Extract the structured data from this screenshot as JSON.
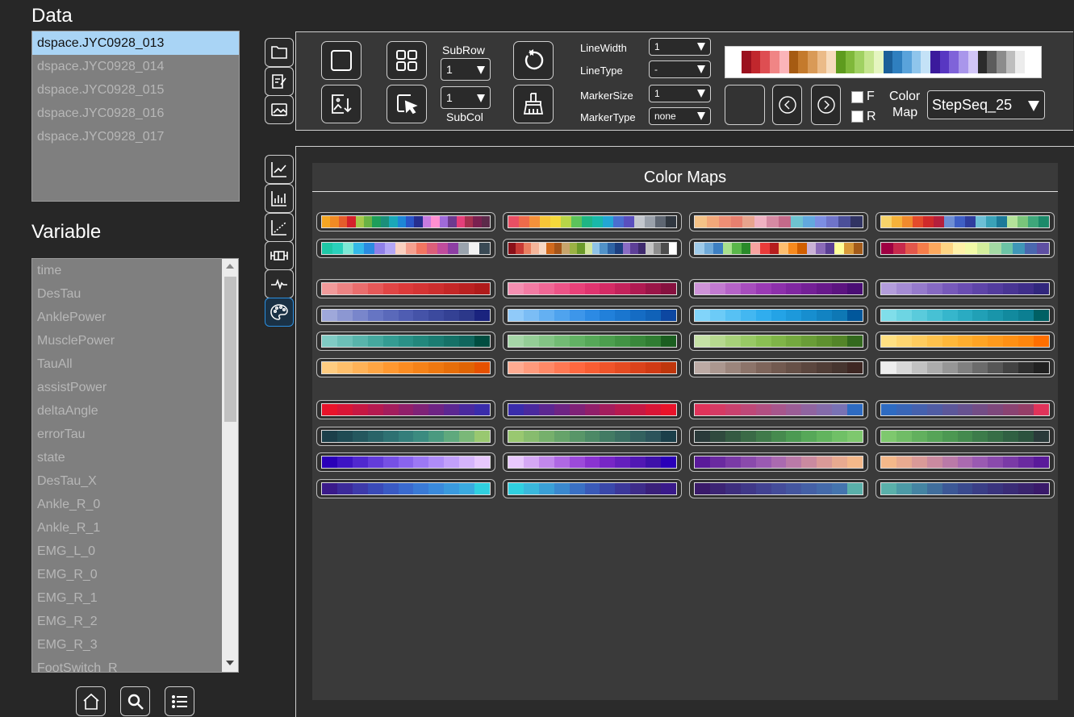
{
  "data_section": {
    "heading": "Data",
    "items": [
      "dspace.JYC0928_013",
      "dspace.JYC0928_014",
      "dspace.JYC0928_015",
      "dspace.JYC0928_016",
      "dspace.JYC0928_017"
    ],
    "selected_index": 0
  },
  "variable_section": {
    "heading": "Variable",
    "items": [
      "time",
      "DesTau",
      "AnklePower",
      "MusclePower",
      "TauAll",
      "assistPower",
      "deltaAngle",
      "errorTau",
      "state",
      "DesTau_X",
      "Ankle_R_0",
      "Ankle_R_1",
      "EMG_L_0",
      "EMG_R_0",
      "EMG_R_1",
      "EMG_R_2",
      "EMG_R_3",
      "FootSwitch_R"
    ]
  },
  "bottom_buttons": [
    "home-icon",
    "search-icon",
    "list-icon"
  ],
  "side_tools_top": [
    "folder-icon",
    "edit-icon",
    "image-icon"
  ],
  "side_tools_bottom": [
    "line-chart-icon",
    "bar-chart-icon",
    "scatter-chart-icon",
    "boxplot-icon",
    "signal-icon",
    "palette-icon"
  ],
  "toolbar": {
    "subrow_label": "SubRow",
    "subrow_value": "1",
    "subcol_label": "SubCol",
    "subcol_value": "1",
    "linewidth_label": "LineWidth",
    "linewidth_value": "1",
    "linetype_label": "LineType",
    "linetype_value": "-",
    "markersize_label": "MarkerSize",
    "markersize_value": "1",
    "markertype_label": "MarkerType",
    "markertype_value": "none",
    "f_label": "F",
    "r_label": "R",
    "colormap_label_1": "Color",
    "colormap_label_2": "Map",
    "colormap_value": "StepSeq_25",
    "preview_colors": [
      "#9b111e",
      "#c1272d",
      "#de4e52",
      "#f08585",
      "#fbb4b9",
      "#a65b12",
      "#c47a2c",
      "#d99a57",
      "#ebbb88",
      "#f7dcbd",
      "#5e9b1e",
      "#7fb83a",
      "#a0d162",
      "#c5e58f",
      "#e5f5c0",
      "#1b5f99",
      "#2f7fbf",
      "#5aa3db",
      "#8fc5ec",
      "#c4e2f7",
      "#3b1a9c",
      "#5837c2",
      "#7f63d9",
      "#a996eb",
      "#d1c5f7",
      "#2b2b2b",
      "#5c5c5c",
      "#8c8c8c",
      "#bebebe",
      "#ececec"
    ]
  },
  "colormaps_panel": {
    "title": "Color Maps",
    "groups": [
      [
        [
          "#f5a623",
          "#f08a24",
          "#e55d2b",
          "#d4222b",
          "#a6c84b",
          "#6ab344",
          "#1e9e5a",
          "#1b8f7b",
          "#1aa8b8",
          "#1d86d6",
          "#2a55c7",
          "#262e8f",
          "#c77be0",
          "#ff8fd0",
          "#9f6ad9",
          "#6d3a8f",
          "#e53f7a",
          "#a6304f",
          "#7a2050",
          "#5c2a4a"
        ],
        [
          "#e94f64",
          "#ef6b4a",
          "#f5913a",
          "#f8c537",
          "#f5d83b",
          "#b8d548",
          "#5cc35b",
          "#1fb584",
          "#19b8a9",
          "#23a6d4",
          "#4a6ed0",
          "#5a4fbe",
          "#c3c7ce",
          "#9aa1ab",
          "#5e6672",
          "#303740"
        ],
        [
          "#f5c287",
          "#f3a87a",
          "#ef8f75",
          "#e8806f",
          "#e8a48d",
          "#f0b2c2",
          "#d68aa3",
          "#c46a8a",
          "#6ec3d0",
          "#62a8de",
          "#7c8ee2",
          "#6f74c9",
          "#4b4f99",
          "#313463"
        ],
        [
          "#f7d36a",
          "#f6b23a",
          "#f08a2d",
          "#e34b2b",
          "#cf2a2a",
          "#b51f3c",
          "#6e8ed3",
          "#3f5fc4",
          "#2f3e9e",
          "#6cbfd6",
          "#3aa2b8",
          "#1d7a99",
          "#b4e39a",
          "#79c47a",
          "#3ea67a",
          "#1c8a6a"
        ],
        [
          "#1ec7a6",
          "#2ad0bb",
          "#7de8d6",
          "#34b9e8",
          "#2b8be0",
          "#8f80e8",
          "#b3a6f5",
          "#fad0c0",
          "#f5a08f",
          "#f27561",
          "#db5e79",
          "#c04c9c",
          "#8d3ea3",
          "#9aa3ad",
          "#f2f2f2",
          "#3a4a55"
        ],
        [
          "#8b1019",
          "#c73a35",
          "#e97f61",
          "#f4b59a",
          "#f7d8c4",
          "#d16a1d",
          "#a5551a",
          "#c7a46b",
          "#9bb244",
          "#6b9a2a",
          "#d3e69b",
          "#8fc2e6",
          "#5192c8",
          "#2e63a4",
          "#1d3f80",
          "#8a6cc4",
          "#5d3f97",
          "#3f2b6e",
          "#c4c4c4",
          "#8d8d8d",
          "#4d4d4d",
          "#ffffff"
        ],
        [
          "#9ecae9",
          "#6fa9d8",
          "#3d7fc2",
          "#a8e08d",
          "#5ab64a",
          "#2a8a2a",
          "#f7a3a0",
          "#e83b3a",
          "#b51e1e",
          "#fdbe6f",
          "#f78a1e",
          "#d15f00",
          "#cab2d6",
          "#8b6bb7",
          "#5b3f94",
          "#ffff99",
          "#d99a3a",
          "#a35b1a"
        ],
        [
          "#9e0142",
          "#c72a4c",
          "#e2574b",
          "#f67d4a",
          "#fca85e",
          "#fed483",
          "#fff1a8",
          "#f2faa7",
          "#d3ed9c",
          "#a4d9a4",
          "#6cc3a5",
          "#3f96b7",
          "#4a67ae",
          "#5e4fa2"
        ]
      ],
      [
        [
          "#f09a9a",
          "#ec8383",
          "#e96d6d",
          "#e55858",
          "#e04545",
          "#dc3a3a",
          "#d53434",
          "#cd2e2e",
          "#c42727",
          "#ba2121",
          "#b01b1b"
        ],
        [
          "#f48fb1",
          "#f27ba3",
          "#ef6795",
          "#ec5387",
          "#e94179",
          "#e0346f",
          "#d42b65",
          "#c3225b",
          "#b01a52",
          "#9a1548",
          "#86113f"
        ],
        [
          "#ce93d8",
          "#c27ad0",
          "#b563c7",
          "#a74dbd",
          "#9a3ab4",
          "#8d30ab",
          "#8027a1",
          "#742096",
          "#68198b",
          "#5c1480",
          "#4a0e74"
        ],
        [
          "#b39ddb",
          "#a48bd3",
          "#957acb",
          "#8669c2",
          "#7759ba",
          "#6a4db2",
          "#5e44a8",
          "#533c9e",
          "#493594",
          "#3f2e8a",
          "#31277d"
        ],
        [
          "#9fa8da",
          "#8c97d2",
          "#7986cb",
          "#6675c3",
          "#5a69ba",
          "#4f5db2",
          "#4553a8",
          "#3c4a9e",
          "#344194",
          "#2c388a",
          "#1a237e"
        ],
        [
          "#90caf9",
          "#7bbdf5",
          "#64b0f2",
          "#4fa3ee",
          "#3d96ea",
          "#2c8ae4",
          "#2180da",
          "#1a76cf",
          "#156cc4",
          "#1062b8",
          "#0d47a1"
        ],
        [
          "#81d4fa",
          "#6ccbf7",
          "#57c1f4",
          "#43b7f1",
          "#30adee",
          "#24a3e6",
          "#1d99db",
          "#178ecf",
          "#1283c2",
          "#0e78b5",
          "#01579b"
        ],
        [
          "#80deea",
          "#6dd5e3",
          "#5acbdc",
          "#47c1d4",
          "#36b6cc",
          "#2aabc2",
          "#21a0b6",
          "#1995aa",
          "#128a9e",
          "#0c7f92",
          "#006064"
        ],
        [
          "#80cbc4",
          "#6cbfb7",
          "#58b4ab",
          "#45a89e",
          "#349c92",
          "#2a9187",
          "#22877c",
          "#1b7c72",
          "#157167",
          "#10665d",
          "#004d40"
        ],
        [
          "#a5d6a7",
          "#94cd96",
          "#83c485",
          "#72bb74",
          "#62b264",
          "#56a858",
          "#4c9e4e",
          "#429344",
          "#39883b",
          "#307d32",
          "#1b5e20"
        ],
        [
          "#c5e1a5",
          "#b6d98f",
          "#a7d179",
          "#98c965",
          "#8ac053",
          "#7fb548",
          "#74a93f",
          "#699d37",
          "#5e912f",
          "#538528",
          "#33691e"
        ],
        [
          "#ffe082",
          "#ffd670",
          "#ffcc5e",
          "#ffc24c",
          "#ffb83a",
          "#ffae2e",
          "#ffa424",
          "#ff9a1c",
          "#ff9014",
          "#ff860d",
          "#ff6f00"
        ],
        [
          "#ffcc80",
          "#ffbf6b",
          "#ffb257",
          "#ffa543",
          "#ff9830",
          "#fb8c22",
          "#f58218",
          "#ee7810",
          "#e76e09",
          "#e06404",
          "#e65100"
        ],
        [
          "#ffab91",
          "#ff9a7c",
          "#ff8967",
          "#ff7853",
          "#ff6840",
          "#f85d33",
          "#ef542a",
          "#e54b22",
          "#db421b",
          "#d13a14",
          "#bf360c"
        ],
        [
          "#bcaaa4",
          "#ab978f",
          "#9b857c",
          "#8c746a",
          "#7e655b",
          "#725a50",
          "#665047",
          "#5b463e",
          "#503d36",
          "#46352f",
          "#3e2723"
        ],
        [
          "#eeeeee",
          "#d8d8d8",
          "#c2c2c2",
          "#acacac",
          "#969696",
          "#808080",
          "#6b6b6b",
          "#565656",
          "#424242",
          "#2f2f2f",
          "#212121"
        ]
      ],
      [
        [
          "#e8132a",
          "#d81536",
          "#c61843",
          "#b51a50",
          "#a31d5d",
          "#911f6a",
          "#7f2277",
          "#6e2484",
          "#5c2791",
          "#4a299e",
          "#3a2cab"
        ],
        [
          "#3a2cab",
          "#4a299e",
          "#5c2791",
          "#6e2484",
          "#7f2277",
          "#911f6a",
          "#a31d5d",
          "#b51a50",
          "#c61843",
          "#d81536",
          "#e8132a"
        ],
        [
          "#e0335a",
          "#d53a64",
          "#c9416e",
          "#be4878",
          "#b24f82",
          "#a7568c",
          "#9b5d96",
          "#9064a0",
          "#846baa",
          "#7972b4",
          "#2e6bc2"
        ],
        [
          "#2e6bc2",
          "#3966b8",
          "#4561ae",
          "#505ca4",
          "#5c579a",
          "#675290",
          "#734d86",
          "#7e487c",
          "#8a4372",
          "#953e68",
          "#e0335a"
        ],
        [
          "#1b3f4a",
          "#1f4b54",
          "#24575e",
          "#296468",
          "#2e7172",
          "#347e7b",
          "#3b8b80",
          "#4a9a80",
          "#5fa97d",
          "#7ab878",
          "#99c870"
        ],
        [
          "#99c870",
          "#87bc6e",
          "#76b06c",
          "#66a36a",
          "#589668",
          "#4c8966",
          "#427b64",
          "#3a6e62",
          "#33615f",
          "#2c545b",
          "#1b3f4a"
        ],
        [
          "#2a3a3a",
          "#2f4a3e",
          "#345a42",
          "#3a6a46",
          "#407a4a",
          "#468a4e",
          "#4c9a52",
          "#56a858",
          "#62b45e",
          "#70c066",
          "#7ec86e"
        ],
        [
          "#7ec86e",
          "#70bc66",
          "#62b05e",
          "#56a458",
          "#4c9852",
          "#448a4e",
          "#3c7c4a",
          "#366e46",
          "#306042",
          "#2c523e",
          "#2a3a3a"
        ],
        [
          "#2a00b8",
          "#3d14c4",
          "#5028cf",
          "#633cda",
          "#7650e4",
          "#8964ee",
          "#9c78f5",
          "#af8cf8",
          "#c2a0fa",
          "#d5b4fc",
          "#e8c8fd"
        ],
        [
          "#e8c8fd",
          "#d5a8f5",
          "#c288ec",
          "#af68e3",
          "#9c4ada",
          "#8a33d0",
          "#7726c6",
          "#641fbd",
          "#5118b3",
          "#3e11a9",
          "#2a00b8"
        ],
        [
          "#5a1a9a",
          "#6a2aa0",
          "#7a3aa6",
          "#8a4aac",
          "#9a5ab2",
          "#aa6ab0",
          "#ba7aa8",
          "#ca8aa0",
          "#da9a98",
          "#e8aa90",
          "#f4b88a"
        ],
        [
          "#f4b88a",
          "#e8aa90",
          "#da9a98",
          "#ca8aa0",
          "#ba7aa8",
          "#aa6ab0",
          "#9a5ab2",
          "#8a4aac",
          "#7a3aa6",
          "#6a2aa0",
          "#5a1a9a"
        ],
        [
          "#3a1a8a",
          "#3c2a9a",
          "#3e3aaa",
          "#3a4ab8",
          "#3a5ac4",
          "#3a6ace",
          "#3a7ad6",
          "#3a8adc",
          "#3a9ade",
          "#3aaadf",
          "#30d0e0"
        ],
        [
          "#30d0e0",
          "#3ab8dc",
          "#3aa0d6",
          "#3a88ce",
          "#3a70c4",
          "#3a5ab8",
          "#3a48aa",
          "#3c389a",
          "#3e2c8a",
          "#3a207a",
          "#3a1a8a"
        ],
        [
          "#3a1a6a",
          "#3c2474",
          "#3e2e7e",
          "#403888",
          "#424292",
          "#444c9a",
          "#4456a0",
          "#4460a6",
          "#446aaa",
          "#4474ae",
          "#5ab0aa"
        ],
        [
          "#5ab0aa",
          "#4c9aa6",
          "#4484a2",
          "#406e9c",
          "#3c5896",
          "#3a4a8e",
          "#3a3e86",
          "#3a347e",
          "#3a2c76",
          "#3a246e",
          "#3a1a6a"
        ]
      ]
    ]
  }
}
